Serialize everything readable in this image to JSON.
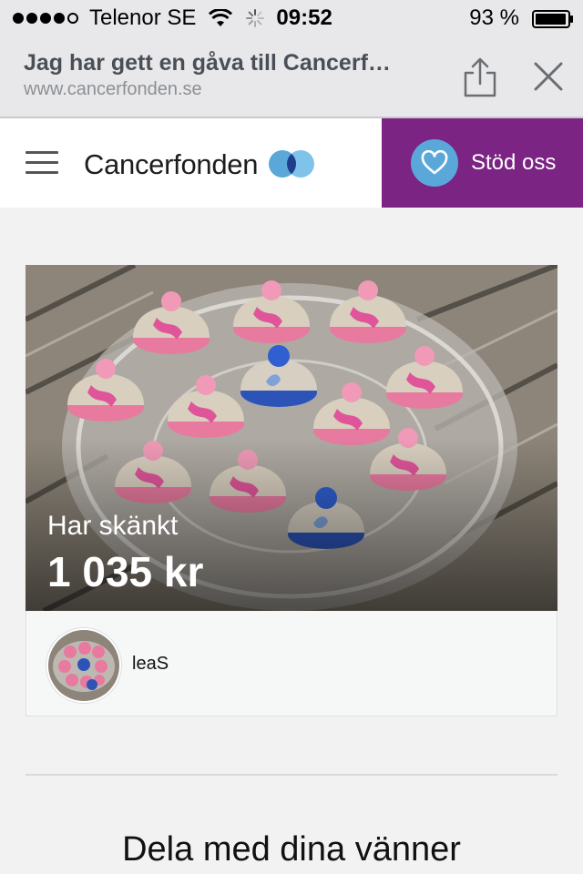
{
  "status_bar": {
    "carrier": "Telenor SE",
    "time": "09:52",
    "battery": "93 %"
  },
  "browser": {
    "title": "Jag har gett en gåva till Cancerf…",
    "url": "www.cancerfonden.se"
  },
  "header": {
    "logo": "Cancerfonden",
    "support_label": "Stöd oss",
    "brand_purple": "#7b2483",
    "brand_blue": "#5aa8da"
  },
  "donation": {
    "label": "Har skänkt",
    "amount": "1 035 kr",
    "donor_name": "leaS"
  },
  "share": {
    "heading": "Dela med dina vänner"
  }
}
